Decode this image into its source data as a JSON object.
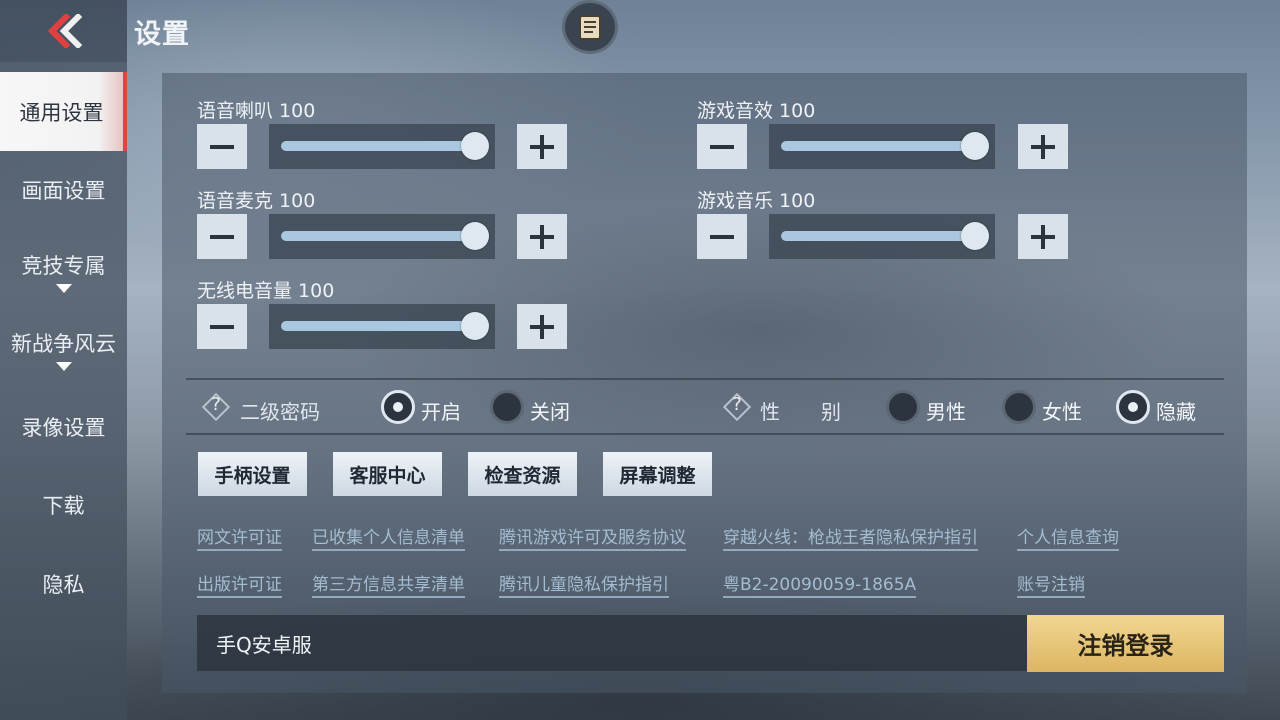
{
  "header": {
    "title": "设置"
  },
  "sidebar": {
    "items": [
      {
        "label": "通用设置"
      },
      {
        "label": "画面设置"
      },
      {
        "label": "竞技专属"
      },
      {
        "label": "新战争风云"
      },
      {
        "label": "录像设置"
      },
      {
        "label": "下载"
      },
      {
        "label": "隐私"
      }
    ]
  },
  "volumes": [
    {
      "label": "语音喇叭",
      "value": "100",
      "level": 1.0
    },
    {
      "label": "游戏音效",
      "value": "100",
      "level": 1.0
    },
    {
      "label": "语音麦克",
      "value": "100",
      "level": 1.0
    },
    {
      "label": "游戏音乐",
      "value": "100",
      "level": 1.0
    },
    {
      "label": "无线电音量",
      "value": "100",
      "level": 1.0
    }
  ],
  "options": {
    "password": {
      "help_icon": "?",
      "label": "二级密码",
      "choices": [
        "开启",
        "关闭"
      ],
      "selected": "开启"
    },
    "gender": {
      "help_icon": "?",
      "label_1": "性",
      "label_2": "别",
      "choices": [
        "男性",
        "女性",
        "隐藏"
      ],
      "selected": "隐藏"
    }
  },
  "actions": [
    "手柄设置",
    "客服中心",
    "检查资源",
    "屏幕调整"
  ],
  "links": {
    "row1": [
      "网文许可证",
      "已收集个人信息清单",
      "腾讯游戏许可及服务协议",
      "穿越火线：枪战王者隐私保护指引",
      "个人信息查询"
    ],
    "row2": [
      "出版许可证",
      "第三方信息共享清单",
      "腾讯儿童隐私保护指引",
      "粤B2-20090059-1865A",
      "账号注销"
    ]
  },
  "footer": {
    "server": "手Q安卓服",
    "logout_label": "注销登录"
  },
  "colors": {
    "accent_gold": "#dcb562",
    "active_tab_marker": "#dd4444",
    "slider_fill": "#a9c7de"
  }
}
